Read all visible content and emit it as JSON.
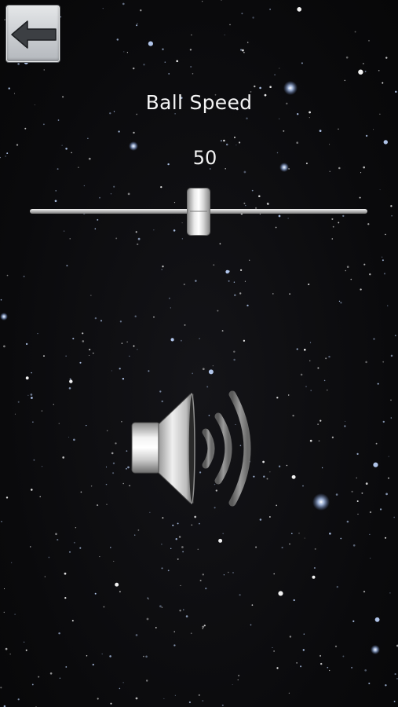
{
  "screen": {
    "title": "Ball Speed",
    "speed_value": "50"
  },
  "slider": {
    "value": 50,
    "min": 0,
    "max": 100
  },
  "icons": {
    "back": "back-arrow-icon",
    "sound": "speaker-icon"
  },
  "colors": {
    "background": "#0b0b0d",
    "text": "#f4f4f4",
    "star": "#cfe2ff"
  }
}
